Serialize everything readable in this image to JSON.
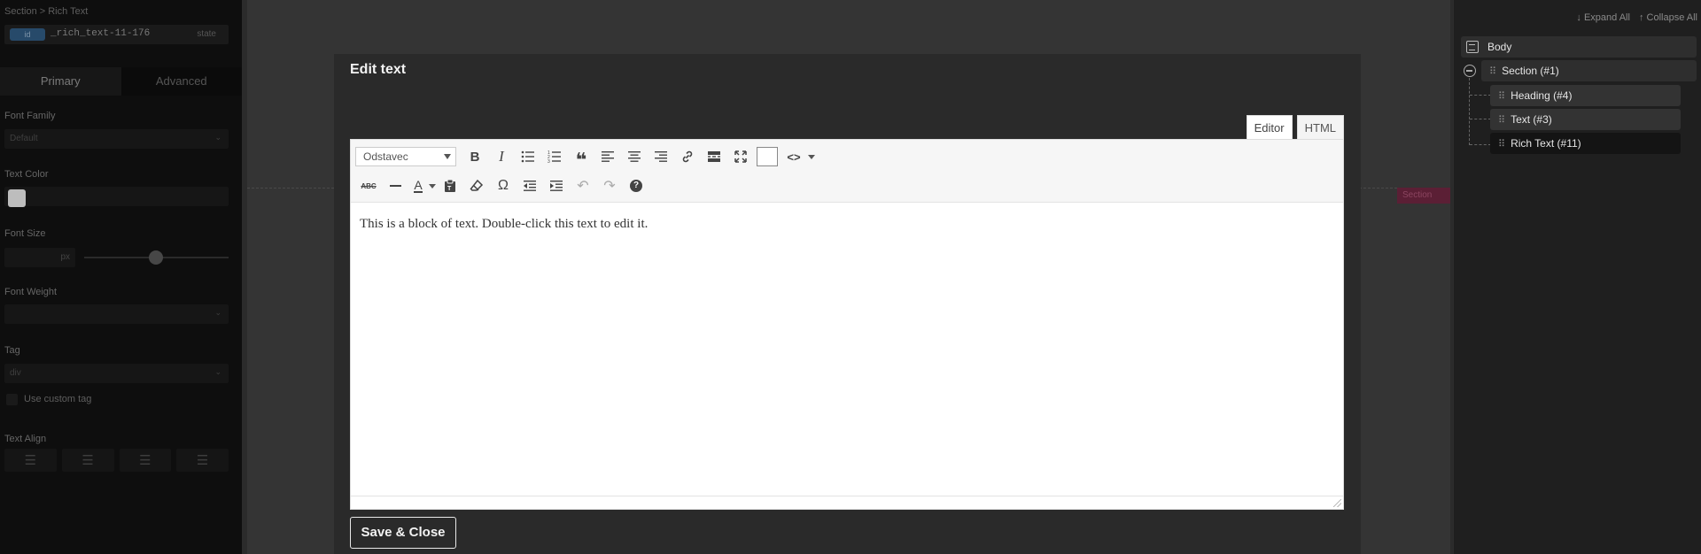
{
  "left_panel": {
    "breadcrumb": "Section > Rich Text",
    "element_id": "_rich_text-11-176",
    "state_label": "state",
    "tabs": {
      "primary": "Primary",
      "advanced": "Advanced"
    },
    "labels": {
      "font_family": "Font Family",
      "text_color": "Text Color",
      "font_size": "Font Size",
      "font_weight": "Font Weight",
      "tag": "Tag",
      "use_custom_tag": "Use custom tag",
      "text_align": "Text Align"
    },
    "font_family_value": "Default",
    "font_size_unit": "px",
    "tag_value": "div",
    "text_color": "#bdbdbd"
  },
  "canvas": {
    "section_tag": "Section"
  },
  "structure": {
    "expand_all": "↓ Expand All",
    "collapse_all": "↑ Collapse All",
    "body": "Body",
    "section": "Section (#1)",
    "children": [
      "Heading (#4)",
      "Text (#3)",
      "Rich Text (#11)"
    ]
  },
  "modal": {
    "title": "Edit text",
    "tab_editor": "Editor",
    "tab_html": "HTML",
    "format_select": "Odstavec",
    "content": "This is a block of text. Double-click this text to edit it.",
    "save_button": "Save & Close"
  },
  "icons": {
    "toolbar_row1": [
      "bold-icon",
      "italic-icon",
      "bullet-list-icon",
      "numbered-list-icon",
      "blockquote-icon",
      "align-left-icon",
      "align-center-icon",
      "align-right-icon",
      "link-icon",
      "read-more-icon",
      "fullscreen-icon",
      "toggle-toolbar-icon",
      "code-icon"
    ],
    "toolbar_row2": [
      "strikethrough-icon",
      "horizontal-line-icon",
      "text-color-icon",
      "paste-text-icon",
      "clear-formatting-icon",
      "special-character-icon",
      "outdent-icon",
      "indent-icon",
      "undo-icon",
      "redo-icon",
      "help-icon"
    ]
  }
}
